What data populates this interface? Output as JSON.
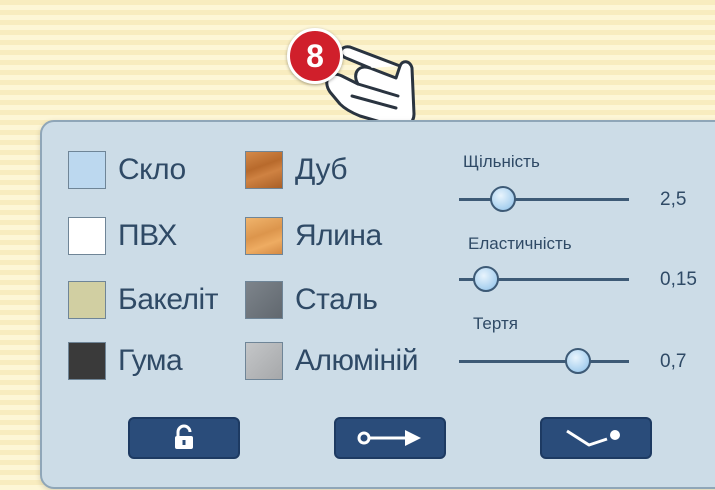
{
  "step_badge": "8",
  "materials": [
    {
      "label": "Скло",
      "color": "#bcd8ef"
    },
    {
      "label": "ПВХ",
      "color": "#ffffff"
    },
    {
      "label": "Бакеліт",
      "color": "#d1cfa2"
    },
    {
      "label": "Гума",
      "color": "#3a3a3a"
    },
    {
      "label": "Дуб",
      "color": "#c57a3c"
    },
    {
      "label": "Ялина",
      "color": "#e8a55e"
    },
    {
      "label": "Сталь",
      "color": "#6f767d"
    },
    {
      "label": "Алюміній",
      "color": "#b5b7b9"
    }
  ],
  "sliders": [
    {
      "title": "Щільність",
      "value": "2,5",
      "level": 0.25
    },
    {
      "title": "Еластичність",
      "value": "0,15",
      "level": 0.15
    },
    {
      "title": "Тертя",
      "value": "0,7",
      "level": 0.7
    }
  ],
  "buttons": [
    {
      "icon": "lock-icon"
    },
    {
      "icon": "arrow-right-icon"
    },
    {
      "icon": "hinge-icon"
    }
  ],
  "colors": {
    "panel_bg": "#ccdce7",
    "button_bg": "#2a4c7a",
    "badge_red": "#d01f2b",
    "text": "#2f4a66"
  }
}
